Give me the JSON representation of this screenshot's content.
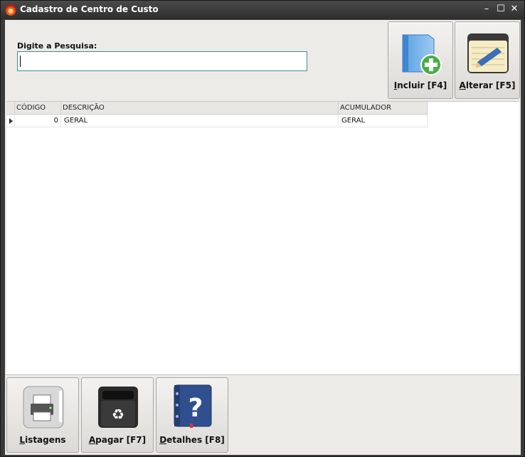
{
  "window": {
    "title": "Cadastro de Centro de Custo",
    "minimize": "–",
    "maximize": "☐",
    "close": "✕"
  },
  "search": {
    "label": "Digite a Pesquisa:",
    "value": "",
    "placeholder": ""
  },
  "top_buttons": {
    "incluir": {
      "accel": "I",
      "rest": "ncluir [F4]",
      "icon": "folder-add-icon"
    },
    "alterar": {
      "accel": "A",
      "rest": "lterar [F5]",
      "icon": "notepad-pencil-icon"
    }
  },
  "grid": {
    "columns": [
      "CÓDIGO",
      "DESCRIÇÃO",
      "ACUMULADOR"
    ],
    "rows": [
      {
        "codigo": "0",
        "descricao": "GERAL",
        "acumulador": "GERAL"
      }
    ]
  },
  "bottom_buttons": {
    "listagens": {
      "accel": "L",
      "rest": "istagens",
      "icon": "printer-icon"
    },
    "apagar": {
      "accel": "A",
      "rest": "pagar [F7]",
      "icon": "recycle-bin-icon"
    },
    "detalhes": {
      "accel": "D",
      "rest": "etalhes [F8]",
      "icon": "help-book-icon"
    }
  },
  "colors": {
    "accent_border": "#3e8e8e",
    "title_bar": "#2e2e2e",
    "panel": "#edebe8"
  }
}
